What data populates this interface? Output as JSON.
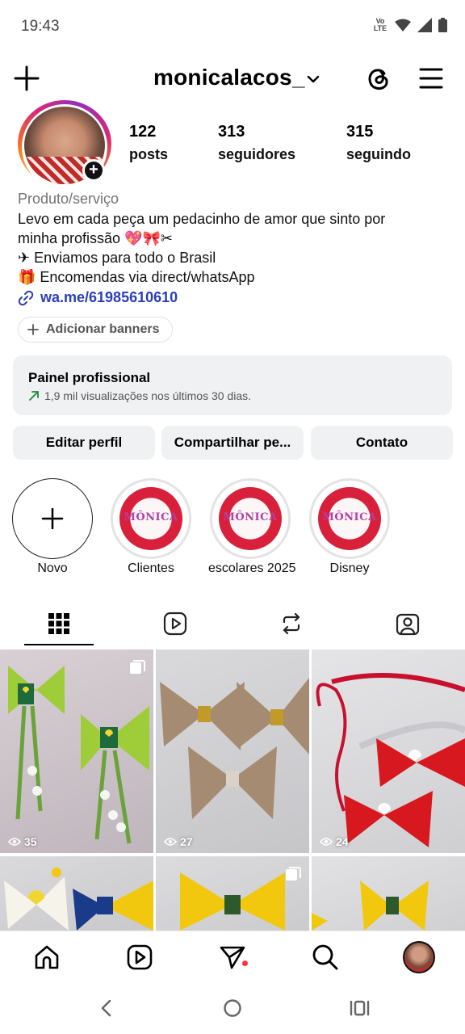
{
  "status_bar": {
    "time": "19:43",
    "network_label": "Vo LTE"
  },
  "header": {
    "username": "monicalacos_"
  },
  "profile": {
    "stats": [
      {
        "count": "122",
        "label": "posts"
      },
      {
        "count": "313",
        "label": "seguidores"
      },
      {
        "count": "315",
        "label": "seguindo"
      }
    ],
    "category": "Produto/serviço",
    "bio_lines": [
      "Levo em cada peça um pedacinho de amor que sinto por",
      "minha profissão 💖🎀✂",
      "✈ Enviamos para todo o Brasil",
      "🎁 Encomendas via direct/whatsApp"
    ],
    "link": "wa.me/61985610610",
    "add_banners_label": "Adicionar banners"
  },
  "professional_panel": {
    "title": "Painel profissional",
    "subtitle": "1,9 mil visualizações nos últimos 30 dias."
  },
  "actions": {
    "edit_profile": "Editar perfil",
    "share_profile": "Compartilhar pe...",
    "contact": "Contato"
  },
  "highlights": {
    "new_label": "Novo",
    "items": [
      {
        "label": "Clientes",
        "logo_text": "MÔNICA"
      },
      {
        "label": "escolares 2025",
        "logo_text": "MÔNICA"
      },
      {
        "label": "Disney",
        "logo_text": "MÔNICA"
      }
    ]
  },
  "tabs": [
    "grid-tab",
    "reels-tab",
    "reposts-tab",
    "tagged-tab"
  ],
  "posts": [
    {
      "views": "35",
      "multi": true
    },
    {
      "views": "27",
      "multi": false
    },
    {
      "views": "24",
      "multi": false
    },
    {
      "views": "",
      "multi": false
    },
    {
      "views": "",
      "multi": true
    },
    {
      "views": "",
      "multi": false
    }
  ],
  "colors": {
    "link": "#2b3fb8",
    "panel_bg": "#eff1f3",
    "notification_dot": "#ff3040",
    "highlight_red": "#d8203a"
  }
}
